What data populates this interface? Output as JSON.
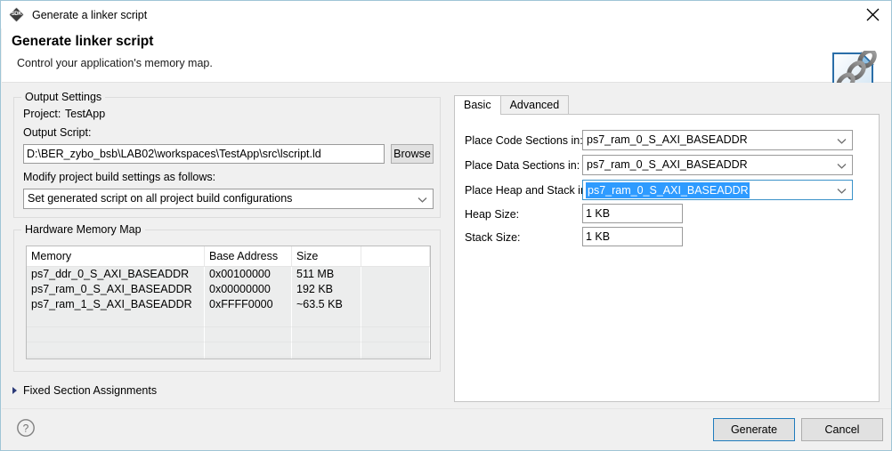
{
  "window": {
    "title": "Generate a linker script",
    "app_icon": "sdk-icon",
    "icon_label": "SDK",
    "close_icon": "close-icon"
  },
  "header": {
    "title": "Generate linker script",
    "subtitle": "Control your application's memory map.",
    "banner_icon": "document-with-chain-icon"
  },
  "left_panel": {
    "output_settings": {
      "legend": "Output Settings",
      "project_label": "Project:",
      "project_value": "TestApp",
      "output_script_label": "Output Script:",
      "output_script_value": "D:\\BER_zybo_bsb\\LAB02\\workspaces\\TestApp\\src\\lscript.ld",
      "browse_label": "Browse",
      "modify_label": "Modify project build settings as follows:",
      "modify_value": "Set generated script on all project build configurations"
    },
    "memory_map": {
      "legend": "Hardware Memory Map",
      "columns": [
        "Memory",
        "Base Address",
        "Size",
        ""
      ],
      "rows": [
        [
          "ps7_ddr_0_S_AXI_BASEADDR",
          "0x00100000",
          "511 MB",
          ""
        ],
        [
          "ps7_ram_0_S_AXI_BASEADDR",
          "0x00000000",
          "192 KB",
          ""
        ],
        [
          "ps7_ram_1_S_AXI_BASEADDR",
          "0xFFFF0000",
          "~63.5 KB",
          ""
        ]
      ],
      "empty_row_count": 4
    },
    "fixed_sections": {
      "label": "Fixed Section Assignments",
      "expander_icon": "triangle-right-icon",
      "expanded": false
    }
  },
  "right_panel": {
    "tabs": [
      {
        "label": "Basic",
        "active": true
      },
      {
        "label": "Advanced",
        "active": false
      }
    ],
    "fields": [
      {
        "label": "Place Code Sections in:",
        "value": "ps7_ram_0_S_AXI_BASEADDR",
        "type": "combo",
        "focused": false
      },
      {
        "label": "Place Data Sections in:",
        "value": "ps7_ram_0_S_AXI_BASEADDR",
        "type": "combo",
        "focused": false
      },
      {
        "label": "Place Heap and Stack in:",
        "value": "ps7_ram_0_S_AXI_BASEADDR",
        "type": "combo",
        "focused": true
      },
      {
        "label": "Heap Size:",
        "value": "1 KB",
        "type": "text",
        "focused": false
      },
      {
        "label": "Stack Size:",
        "value": "1 KB",
        "type": "text",
        "focused": false
      }
    ]
  },
  "footer": {
    "help_icon": "help-question-icon",
    "generate_label": "Generate",
    "cancel_label": "Cancel"
  },
  "colors": {
    "accent_blue": "#1f7bbd",
    "selection_blue": "#2e9bff",
    "window_border": "#9fc5d6",
    "body_bg": "#f0f0f0",
    "white": "#ffffff",
    "table_row_bg": "#eceded"
  }
}
